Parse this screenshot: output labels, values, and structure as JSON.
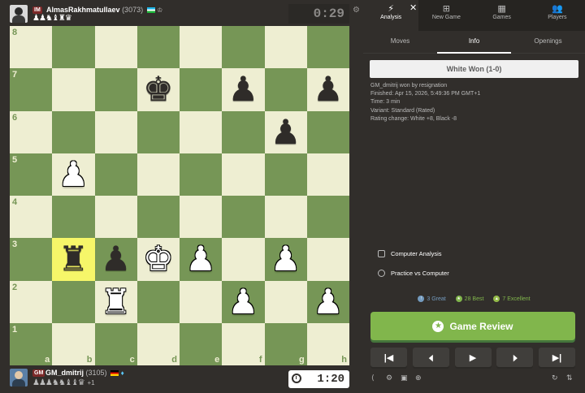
{
  "top_player": {
    "title": "IM",
    "name": "AlmasRakhmatullaev",
    "rating": "(3073)",
    "captured": "♟♟♞♝♜♛",
    "clock": "0:29"
  },
  "bottom_player": {
    "title": "GM",
    "name": "GM_dmitrij",
    "rating": "(3105)",
    "captured": "♟♟♟♞♞♝♝♛",
    "advantage": "+1",
    "clock": "1:20"
  },
  "board": {
    "ranks": [
      "8",
      "7",
      "6",
      "5",
      "4",
      "3",
      "2",
      "1"
    ],
    "files": [
      "a",
      "b",
      "c",
      "d",
      "e",
      "f",
      "g",
      "h"
    ],
    "highlight": [
      "b3"
    ],
    "pieces": {
      "d7": "bK",
      "f7": "bP",
      "h7": "bP",
      "g6": "bP",
      "b5": "wP",
      "b3": "bR",
      "c3": "bP",
      "d3": "wK",
      "e3": "wP",
      "g3": "wP",
      "c2": "wR",
      "f2": "wP",
      "h2": "wP"
    }
  },
  "tabs": [
    {
      "label": "Analysis",
      "icon": "⚡"
    },
    {
      "label": "New Game",
      "icon": "⊞"
    },
    {
      "label": "Games",
      "icon": "▦"
    },
    {
      "label": "Players",
      "icon": "👥"
    }
  ],
  "subtabs": [
    "Moves",
    "Info",
    "Openings"
  ],
  "result": "White Won (1-0)",
  "info": [
    "GM_dmitrij won by resignation",
    "Finished: Apr 15, 2026, 5:49:36 PM GMT+1",
    "Time: 3 min",
    "Variant: Standard (Rated)",
    "Rating change: White +8, Black -8"
  ],
  "links": {
    "computer_analysis": "Computer Analysis",
    "practice": "Practice vs Computer"
  },
  "stats": {
    "great": "3 Great",
    "best": "28 Best",
    "excellent": "7 Excellent"
  },
  "review_button": "Game Review",
  "nav": [
    "|◀",
    "◀",
    "▶",
    "▶",
    "▶|"
  ],
  "colors": {
    "light_square": "#eeeed2",
    "dark_square": "#769656",
    "highlight": "#f6f669",
    "review_green": "#81b64c"
  }
}
